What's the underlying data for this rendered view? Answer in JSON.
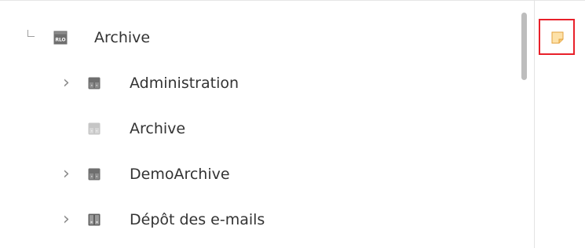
{
  "tree": {
    "root": {
      "label": "Archive",
      "icon": "repository-icon",
      "icon_text": "RLO"
    },
    "items": [
      {
        "label": "Administration",
        "icon": "cabinet-icon",
        "expandable": true
      },
      {
        "label": "Archive",
        "icon": "cabinet-icon",
        "expandable": false
      },
      {
        "label": "DemoArchive",
        "icon": "cabinet-icon",
        "expandable": true
      },
      {
        "label": "Dépôt des e-mails",
        "icon": "mail-cabinet-icon",
        "expandable": true
      }
    ]
  },
  "side_panel": {
    "note_icon": "sticky-note-icon"
  },
  "colors": {
    "highlight_border": "#e8202a",
    "note_fill": "#fde1a8",
    "note_stroke": "#e3a23e",
    "icon_dark": "#6f6f6f",
    "icon_light": "#bdbdbd"
  }
}
